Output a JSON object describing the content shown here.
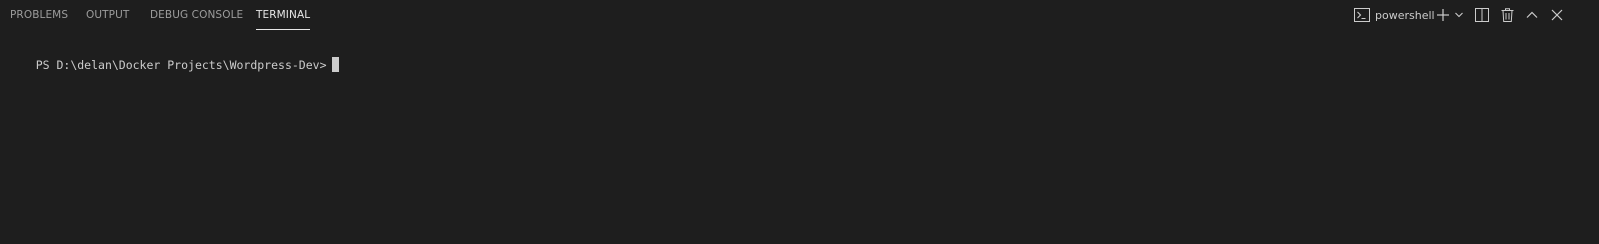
{
  "panel": {
    "tabs": [
      {
        "label": "PROBLEMS",
        "active": false
      },
      {
        "label": "OUTPUT",
        "active": false
      },
      {
        "label": "DEBUG CONSOLE",
        "active": false
      },
      {
        "label": "TERMINAL",
        "active": true
      }
    ],
    "actions": {
      "terminal_icon": "terminal-icon",
      "shell_label": "powershell",
      "new_terminal_icon": "plus-icon",
      "launch_profile_icon": "chevron-down-icon",
      "split_icon": "split-icon",
      "kill_icon": "trash-icon",
      "maximize_icon": "chevron-up-icon",
      "close_icon": "close-icon"
    }
  },
  "terminal": {
    "prompt": "PS D:\\delan\\Docker Projects\\Wordpress-Dev>"
  },
  "colors": {
    "background": "#1e1e1e",
    "text": "#cccccc",
    "inactive_tab": "#9d9d9d",
    "active_tab": "#e7e7e7"
  }
}
